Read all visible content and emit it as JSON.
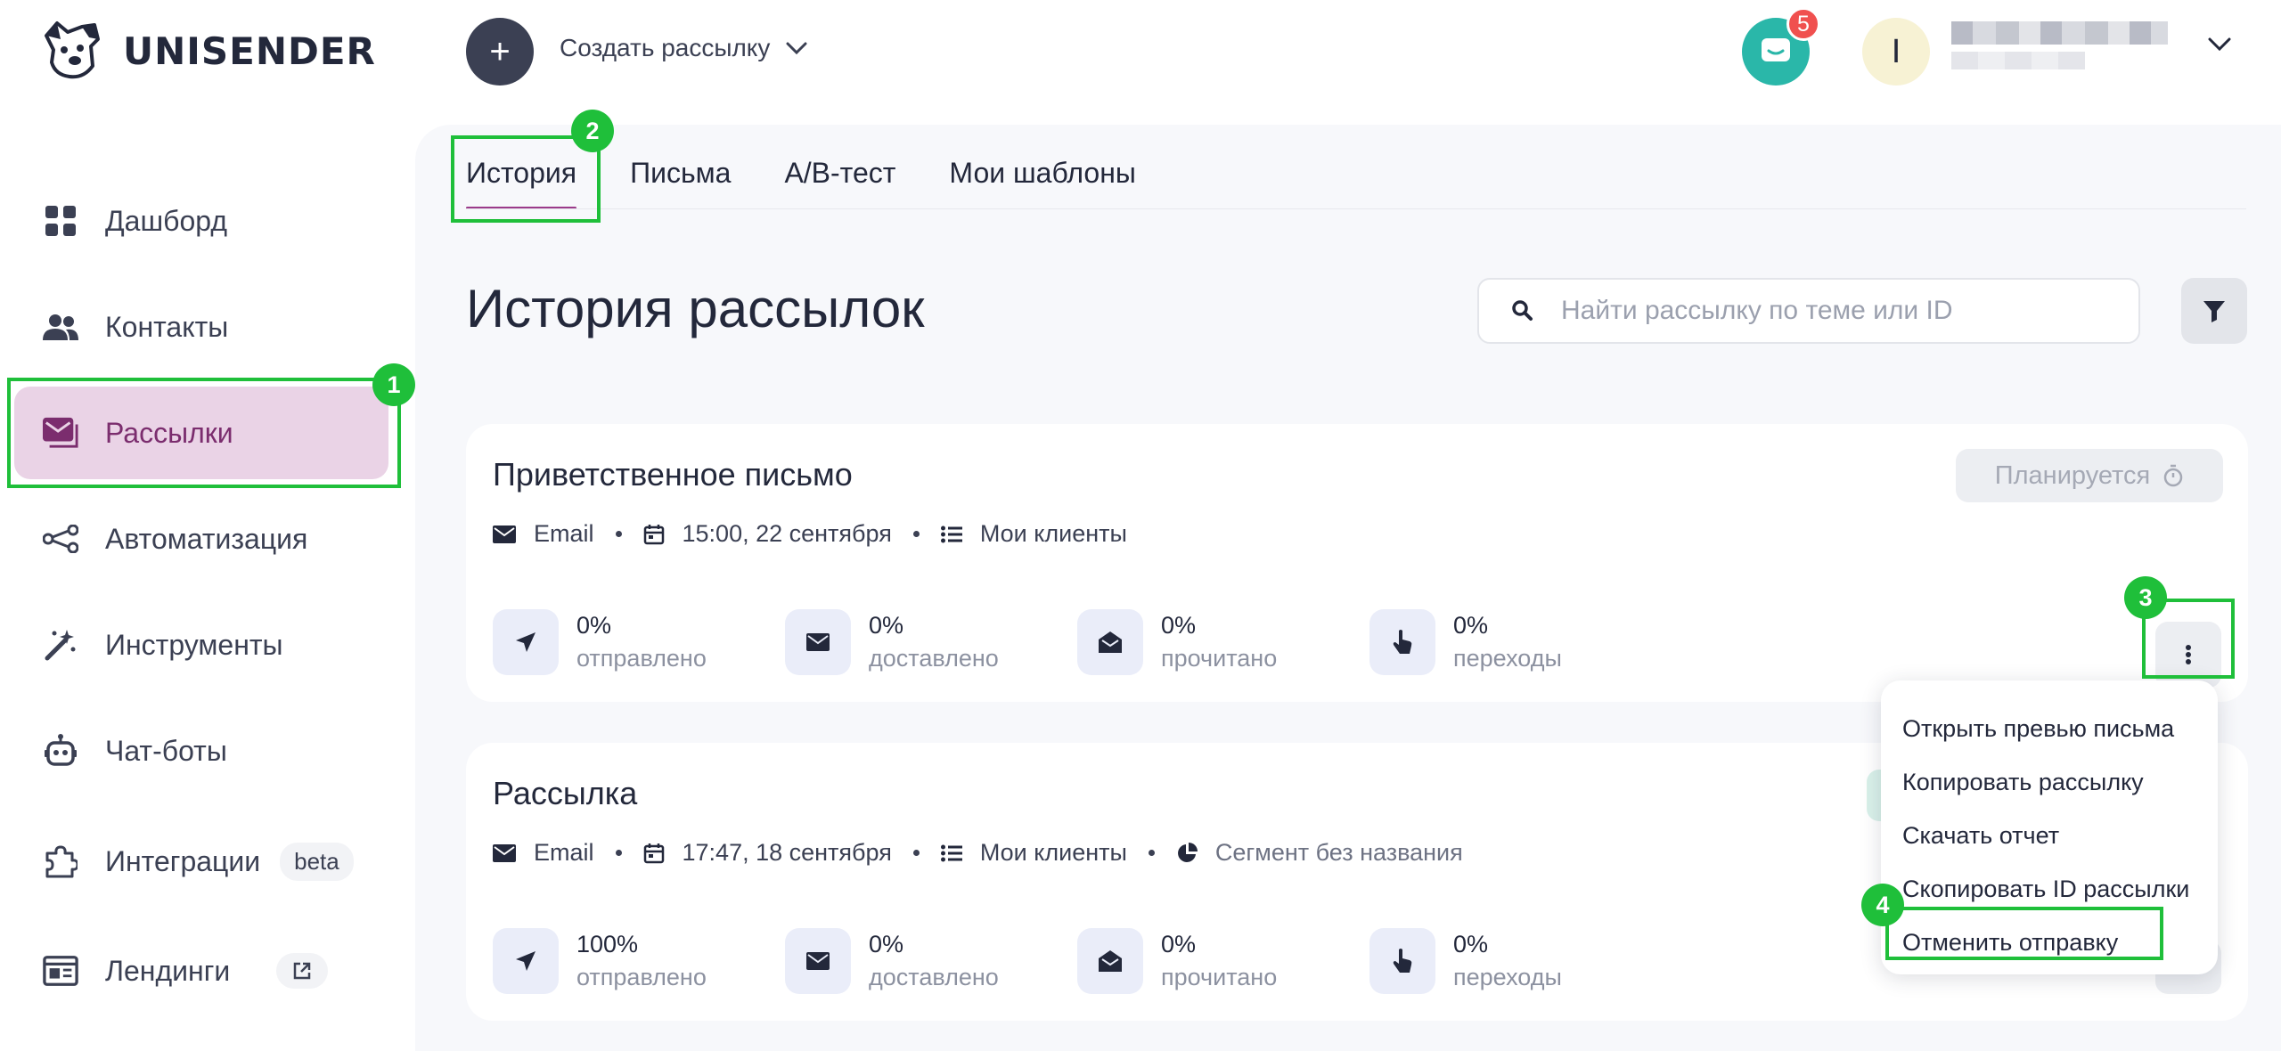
{
  "header": {
    "logo_text": "UNISENDER",
    "create_label": "Создать рассылку",
    "notification_count": "5",
    "avatar_initial": "I"
  },
  "sidebar": {
    "items": [
      {
        "label": "Дашборд",
        "icon": "dashboard-icon"
      },
      {
        "label": "Контакты",
        "icon": "contacts-icon"
      },
      {
        "label": "Рассылки",
        "icon": "mailings-icon",
        "active": true
      },
      {
        "label": "Автоматизация",
        "icon": "automation-icon"
      },
      {
        "label": "Инструменты",
        "icon": "tools-icon"
      },
      {
        "label": "Чат-боты",
        "icon": "chatbot-icon"
      },
      {
        "label": "Интеграции",
        "icon": "integrations-icon",
        "pill": "beta"
      },
      {
        "label": "Лендинги",
        "icon": "landing-icon"
      }
    ]
  },
  "tabs": [
    {
      "label": "История",
      "active": true
    },
    {
      "label": "Письма"
    },
    {
      "label": "A/B-тест"
    },
    {
      "label": "Мои шаблоны"
    }
  ],
  "page": {
    "title": "История рассылок",
    "search_placeholder": "Найти рассылку по теме или ID"
  },
  "campaigns": [
    {
      "title": "Приветственное письмо",
      "status": "Планируется",
      "channel": "Email",
      "datetime": "15:00, 22 сентября",
      "list": "Мои клиенты",
      "stats": [
        {
          "value": "0%",
          "label": "отправлено"
        },
        {
          "value": "0%",
          "label": "доставлено"
        },
        {
          "value": "0%",
          "label": "прочитано"
        },
        {
          "value": "0%",
          "label": "переходы"
        }
      ]
    },
    {
      "title": "Рассылка",
      "channel": "Email",
      "datetime": "17:47, 18 сентября",
      "list": "Мои клиенты",
      "segment": "Сегмент без названия",
      "stats": [
        {
          "value": "100%",
          "label": "отправлено"
        },
        {
          "value": "0%",
          "label": "доставлено"
        },
        {
          "value": "0%",
          "label": "прочитано"
        },
        {
          "value": "0%",
          "label": "переходы"
        }
      ]
    }
  ],
  "dropdown": {
    "items": [
      "Открыть превью письма",
      "Копировать рассылку",
      "Скачать отчет",
      "Скопировать ID рассылки",
      "Отменить отправку"
    ]
  },
  "annotations": [
    "1",
    "2",
    "3",
    "4"
  ],
  "colors": {
    "accent": "#9b3b8a",
    "active_bg": "#ead3e6",
    "highlight": "#1fbf3a",
    "chat": "#2ab7a9",
    "badge": "#f0504f"
  }
}
